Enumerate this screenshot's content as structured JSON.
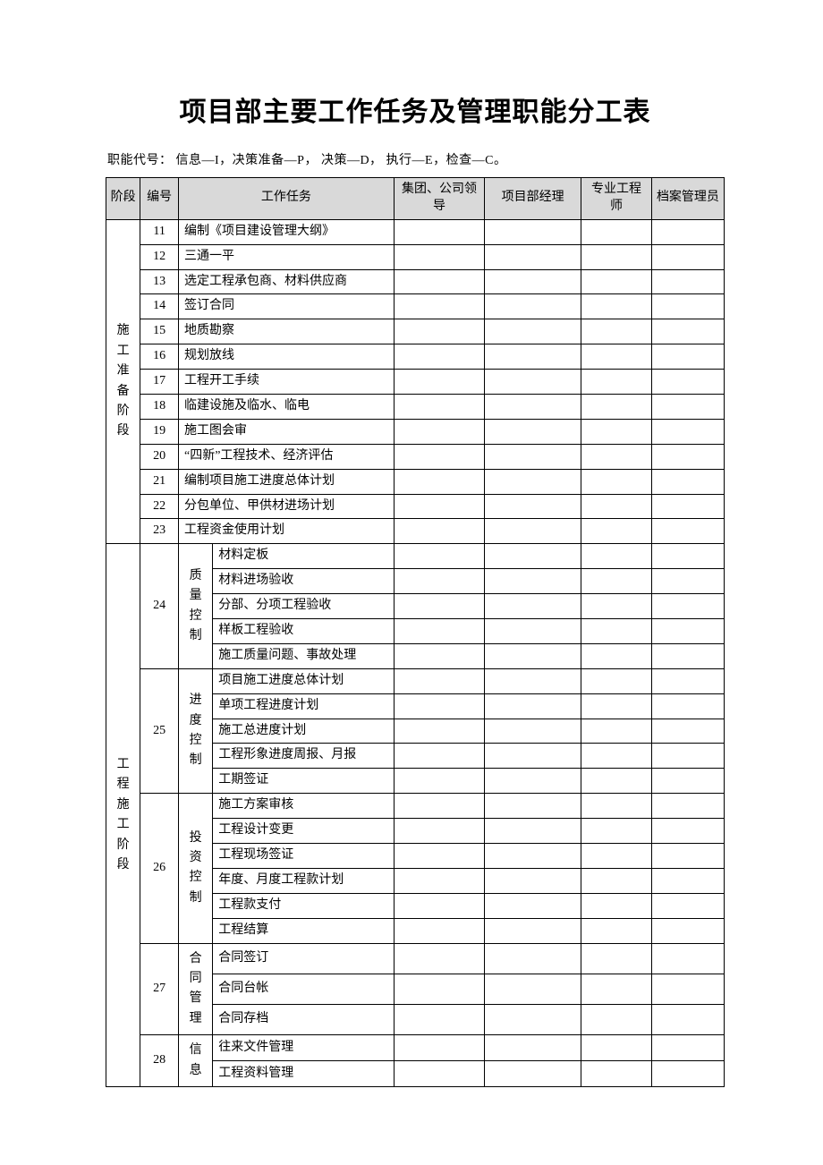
{
  "title": "项目部主要工作任务及管理职能分工表",
  "legend": "职能代号：  信息—I，决策准备—P，  决策—D，  执行—E，检查—C。",
  "headers": {
    "phase": "阶段",
    "no": "编号",
    "task": "工作任务",
    "colA": "集团、公司领导",
    "colB": "项目部经理",
    "colC": "专业工程师",
    "colD": "档案管理员"
  },
  "phase1": {
    "label": "施工准备阶段",
    "rows": [
      {
        "no": "11",
        "task": "编制《项目建设管理大纲》",
        "a": "",
        "b": "",
        "c": "",
        "d": ""
      },
      {
        "no": "12",
        "task": "三通一平",
        "a": "",
        "b": "",
        "c": "",
        "d": ""
      },
      {
        "no": "13",
        "task": "选定工程承包商、材料供应商",
        "a": "",
        "b": "",
        "c": "",
        "d": ""
      },
      {
        "no": "14",
        "task": "签订合同",
        "a": "",
        "b": "",
        "c": "",
        "d": ""
      },
      {
        "no": "15",
        "task": "地质勘察",
        "a": "",
        "b": "",
        "c": "",
        "d": ""
      },
      {
        "no": "16",
        "task": "规划放线",
        "a": "",
        "b": "",
        "c": "",
        "d": ""
      },
      {
        "no": "17",
        "task": "工程开工手续",
        "a": "",
        "b": "",
        "c": "",
        "d": ""
      },
      {
        "no": "18",
        "task": "临建设施及临水、临电",
        "a": "",
        "b": "",
        "c": "",
        "d": ""
      },
      {
        "no": "19",
        "task": "施工图会审",
        "a": "",
        "b": "",
        "c": "",
        "d": ""
      },
      {
        "no": "20",
        "task": "“四新”工程技术、经济评估",
        "a": "",
        "b": "",
        "c": "",
        "d": ""
      },
      {
        "no": "21",
        "task": "编制项目施工进度总体计划",
        "a": "",
        "b": "",
        "c": "",
        "d": ""
      },
      {
        "no": "22",
        "task": "分包单位、甲供材进场计划",
        "a": "",
        "b": "",
        "c": "",
        "d": ""
      },
      {
        "no": "23",
        "task": "工程资金使用计划",
        "a": "",
        "b": "",
        "c": "",
        "d": ""
      }
    ]
  },
  "phase2": {
    "label": "工程施工阶段",
    "groups": [
      {
        "no": "24",
        "sub": "质量控制",
        "items": [
          {
            "task": "材料定板",
            "a": "",
            "b": "",
            "c": "",
            "d": ""
          },
          {
            "task": "材料进场验收",
            "a": "",
            "b": "",
            "c": "",
            "d": ""
          },
          {
            "task": "分部、分项工程验收",
            "a": "",
            "b": "",
            "c": "",
            "d": ""
          },
          {
            "task": "样板工程验收",
            "a": "",
            "b": "",
            "c": "",
            "d": ""
          },
          {
            "task": "施工质量问题、事故处理",
            "a": "",
            "b": "",
            "c": "",
            "d": ""
          }
        ]
      },
      {
        "no": "25",
        "sub": "进度控制",
        "items": [
          {
            "task": "项目施工进度总体计划",
            "a": "",
            "b": "",
            "c": "",
            "d": ""
          },
          {
            "task": "单项工程进度计划",
            "a": "",
            "b": "",
            "c": "",
            "d": ""
          },
          {
            "task": "施工总进度计划",
            "a": "",
            "b": "",
            "c": "",
            "d": ""
          },
          {
            "task": "工程形象进度周报、月报",
            "a": "",
            "b": "",
            "c": "",
            "d": ""
          },
          {
            "task": "工期签证",
            "a": "",
            "b": "",
            "c": "",
            "d": ""
          }
        ]
      },
      {
        "no": "26",
        "sub": "投资控制",
        "items": [
          {
            "task": "施工方案审核",
            "a": "",
            "b": "",
            "c": "",
            "d": ""
          },
          {
            "task": "工程设计变更",
            "a": "",
            "b": "",
            "c": "",
            "d": ""
          },
          {
            "task": "工程现场签证",
            "a": "",
            "b": "",
            "c": "",
            "d": ""
          },
          {
            "task": "年度、月度工程款计划",
            "a": "",
            "b": "",
            "c": "",
            "d": ""
          },
          {
            "task": "工程款支付",
            "a": "",
            "b": "",
            "c": "",
            "d": ""
          },
          {
            "task": "工程结算",
            "a": "",
            "b": "",
            "c": "",
            "d": ""
          }
        ]
      },
      {
        "no": "27",
        "sub": "合同管理",
        "items": [
          {
            "task": "合同签订",
            "a": "",
            "b": "",
            "c": "",
            "d": ""
          },
          {
            "task": "合同台帐",
            "a": "",
            "b": "",
            "c": "",
            "d": ""
          },
          {
            "task": "合同存档",
            "a": "",
            "b": "",
            "c": "",
            "d": ""
          }
        ]
      },
      {
        "no": "28",
        "sub": "信息",
        "items": [
          {
            "task": "往来文件管理",
            "a": "",
            "b": "",
            "c": "",
            "d": ""
          },
          {
            "task": "工程资料管理",
            "a": "",
            "b": "",
            "c": "",
            "d": ""
          }
        ]
      }
    ]
  }
}
